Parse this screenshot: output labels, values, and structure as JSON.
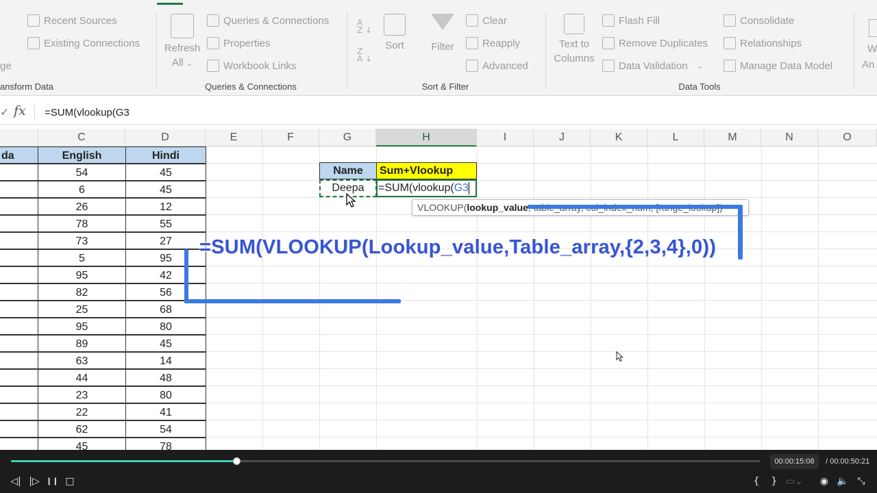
{
  "ribbon": {
    "get_transform": {
      "recent_sources": "Recent Sources",
      "existing_connections": "Existing Connections",
      "partial_label": "ge",
      "group_label": "ansform Data"
    },
    "queries": {
      "refresh": "Refresh",
      "refresh_all": "All",
      "queries_connections": "Queries & Connections",
      "properties": "Properties",
      "workbook_links": "Workbook Links",
      "group_label": "Queries & Connections"
    },
    "sort_filter": {
      "sort": "Sort",
      "filter": "Filter",
      "clear": "Clear",
      "reapply": "Reapply",
      "advanced": "Advanced",
      "group_label": "Sort & Filter"
    },
    "data_tools": {
      "text_to": "Text to",
      "columns": "Columns",
      "flash_fill": "Flash Fill",
      "remove_duplicates": "Remove Duplicates",
      "data_validation": "Data Validation",
      "consolidate": "Consolidate",
      "relationships": "Relationships",
      "manage_data_model": "Manage Data Model",
      "group_label": "Data Tools"
    },
    "partial_right_1": "W",
    "partial_right_2": "An"
  },
  "formula_bar": {
    "check": "✓",
    "fx": "fx",
    "formula": "=SUM(vlookup(G3"
  },
  "grid": {
    "columns": [
      {
        "label": "C"
      },
      {
        "label": "D"
      },
      {
        "label": "E"
      },
      {
        "label": "F"
      },
      {
        "label": "G"
      },
      {
        "label": "H"
      },
      {
        "label": "I"
      },
      {
        "label": "J"
      },
      {
        "label": "K"
      },
      {
        "label": "L"
      },
      {
        "label": "M"
      },
      {
        "label": "N"
      },
      {
        "label": "O"
      }
    ],
    "table_headers": {
      "partial": "da",
      "english": "English",
      "hindi": "Hindi"
    },
    "rows": [
      {
        "english": "54",
        "hindi": "45"
      },
      {
        "english": "6",
        "hindi": "45"
      },
      {
        "english": "26",
        "hindi": "12"
      },
      {
        "english": "78",
        "hindi": "55"
      },
      {
        "english": "73",
        "hindi": "27"
      },
      {
        "english": "5",
        "hindi": "95"
      },
      {
        "english": "95",
        "hindi": "42"
      },
      {
        "english": "82",
        "hindi": "56"
      },
      {
        "english": "25",
        "hindi": "68"
      },
      {
        "english": "95",
        "hindi": "80"
      },
      {
        "english": "89",
        "hindi": "45"
      },
      {
        "english": "63",
        "hindi": "14"
      },
      {
        "english": "44",
        "hindi": "48"
      },
      {
        "english": "23",
        "hindi": "80"
      },
      {
        "english": "22",
        "hindi": "41"
      },
      {
        "english": "62",
        "hindi": "54"
      },
      {
        "english": "45",
        "hindi": "78"
      }
    ],
    "lookup_table": {
      "name_header": "Name",
      "sum_header": "Sum+Vlookup",
      "name_value": "Deepa",
      "edit_prefix": "=SUM(vlookup(",
      "edit_ref": "G3"
    },
    "tooltip": {
      "fn": "VLOOKUP(",
      "arg_bold": "lookup_value",
      "rest": ", table_array, col_index_num, [range_lookup])"
    },
    "annotation": "=SUM(VLOOKUP(Lookup_value,Table_array,{2,3,4},0))"
  },
  "colors": {
    "header_blue": "#bdd7ee",
    "highlight_yellow": "#ffff00",
    "excel_green": "#1d7a43",
    "annotation_blue": "#3556d4",
    "progress_teal": "#3ed3b2"
  },
  "player": {
    "current_time": "00:00:15:08",
    "total_time": "/  00:00:50:21",
    "progress": 0.301,
    "controls": {
      "prev_frame": "◁|",
      "next_frame": "|▷",
      "pause": "❙❙",
      "stop": "□",
      "mark_in": "{",
      "mark_out": "}",
      "snapshot": "◉",
      "volume": "🔈",
      "fullscreen": "⤡"
    }
  }
}
